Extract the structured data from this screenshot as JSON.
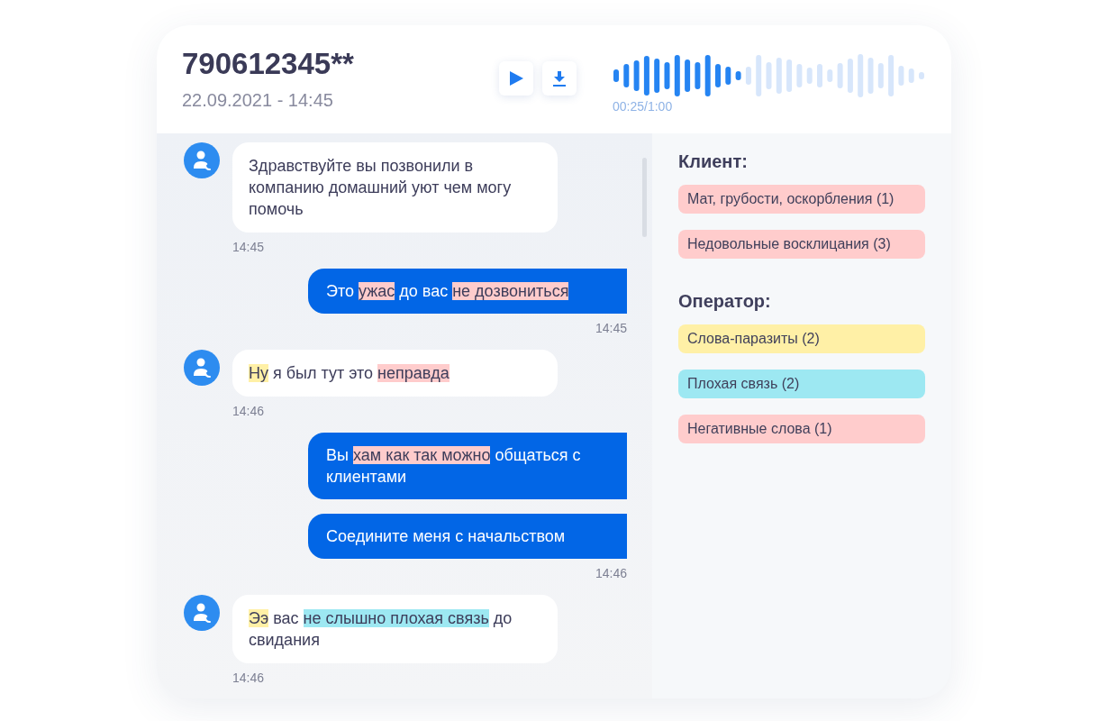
{
  "call": {
    "number": "790612345**",
    "datetime": "22.09.2021 - 14:45"
  },
  "player": {
    "level": 0.42,
    "time": "00:25/1:00"
  },
  "messages": [
    {
      "kind": "incoming",
      "parts": [
        {
          "text": "Здравствуйте вы позвонили в компанию домашний уют чем могу помочь"
        }
      ],
      "time": "14:45"
    },
    {
      "kind": "outgoing",
      "parts": [
        {
          "text": "Это "
        },
        {
          "text": "ужас",
          "color": "#ffcccc"
        },
        {
          "text": " до вас "
        },
        {
          "text": "не дозвониться",
          "color": "#ffcccc"
        }
      ],
      "time": "14:45"
    },
    {
      "kind": "incoming",
      "parts": [
        {
          "text": "Ну",
          "color": "#fff0a6"
        },
        {
          "text": " я был тут это "
        },
        {
          "text": "неправда",
          "color": "#ffcccc"
        }
      ],
      "time": "14:46"
    },
    {
      "kind": "outgoing",
      "parts": [
        {
          "text": "Вы "
        },
        {
          "text": "хам ",
          "color": "#ffcccc"
        },
        {
          "text": "как так можно",
          "color": "#ffcccc"
        },
        {
          "text": " общаться с клиентами"
        }
      ]
    },
    {
      "kind": "outgoing",
      "parts": [
        {
          "text": "Соедините меня с начальством"
        }
      ],
      "time": "14:46"
    },
    {
      "kind": "incoming",
      "parts": [
        {
          "text": "Ээ",
          "color": "#fff0a6"
        },
        {
          "text": " вас "
        },
        {
          "text": "не слышно ",
          "color": "#9de8f2"
        },
        {
          "text": "плохая связь",
          "color": "#9de8f2"
        },
        {
          "text": " до свидания"
        }
      ],
      "time": "14:46"
    }
  ],
  "groups": [
    {
      "title": "Клиент:",
      "tags": [
        {
          "label": "Мат, грубости, оскорбления (1)",
          "color": "#ffcccc"
        },
        {
          "label": "Недовольные восклицания (3)",
          "color": "#ffcccc"
        }
      ]
    },
    {
      "title": "Оператор:",
      "tags": [
        {
          "label": "Слова-паразиты (2)",
          "color": "#fff0a6"
        },
        {
          "label": "Плохая связь (2)",
          "color": "#9de8f2"
        },
        {
          "label": "Негативные слова (1)",
          "color": "#ffcccc"
        }
      ]
    }
  ]
}
